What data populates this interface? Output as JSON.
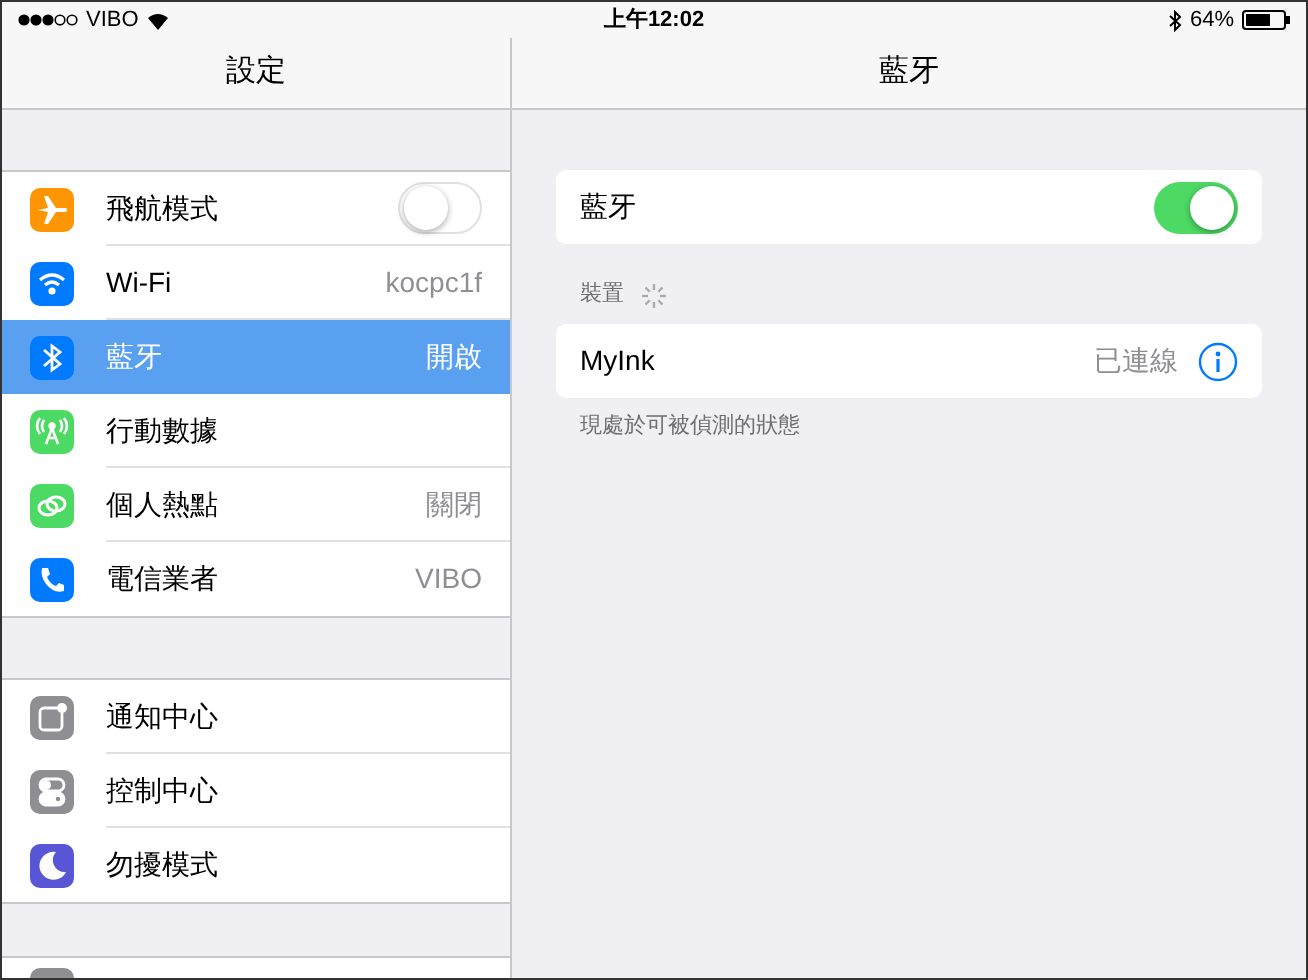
{
  "status_bar": {
    "carrier": "VIBO",
    "time": "上午12:02",
    "battery": "64%"
  },
  "master": {
    "title": "設定",
    "groups": [
      [
        {
          "label": "飛航模式",
          "kind": "toggle",
          "on": false,
          "selected": false
        },
        {
          "label": "Wi-Fi",
          "kind": "detail",
          "value": "kocpc1f",
          "selected": false
        },
        {
          "label": "藍牙",
          "kind": "detail",
          "value": "開啟",
          "selected": true
        },
        {
          "label": "行動數據",
          "kind": "detail",
          "selected": false
        },
        {
          "label": "個人熱點",
          "kind": "detail",
          "value": "關閉",
          "selected": false
        },
        {
          "label": "電信業者",
          "kind": "detail",
          "value": "VIBO",
          "selected": false
        }
      ],
      [
        {
          "label": "通知中心",
          "kind": "detail",
          "selected": false
        },
        {
          "label": "控制中心",
          "kind": "detail",
          "selected": false
        },
        {
          "label": "勿擾模式",
          "kind": "detail",
          "selected": false
        }
      ]
    ]
  },
  "detail": {
    "title": "藍牙",
    "toggle": {
      "label": "藍牙",
      "on": true
    },
    "section": "裝置",
    "devices": [
      {
        "name": "MyInk",
        "status": "已連線"
      }
    ],
    "footer": "現處於可被偵測的狀態"
  }
}
